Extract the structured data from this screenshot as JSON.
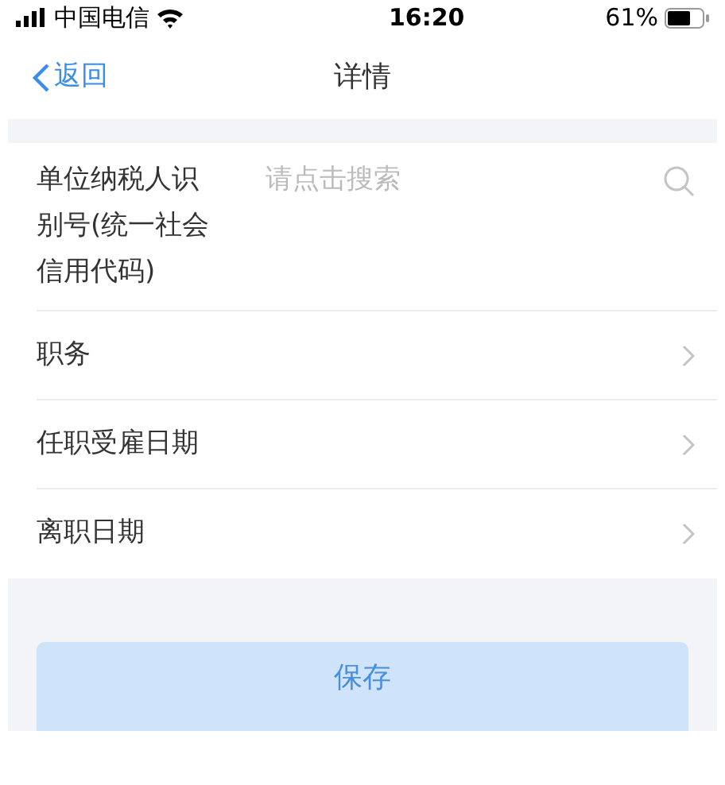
{
  "status_bar": {
    "carrier": "中国电信",
    "time": "16:20",
    "battery": "61%"
  },
  "nav": {
    "back": "返回",
    "title": "详情"
  },
  "rows": [
    {
      "kind": "search",
      "label": "单位纳税人识别号(统一社会信用代码)",
      "placeholder": "请点击搜索"
    },
    {
      "kind": "link",
      "label": "职务"
    },
    {
      "kind": "link",
      "label": "任职受雇日期"
    },
    {
      "kind": "link",
      "label": "离职日期"
    }
  ],
  "save_button": {
    "label": "保存",
    "disabled": true
  }
}
